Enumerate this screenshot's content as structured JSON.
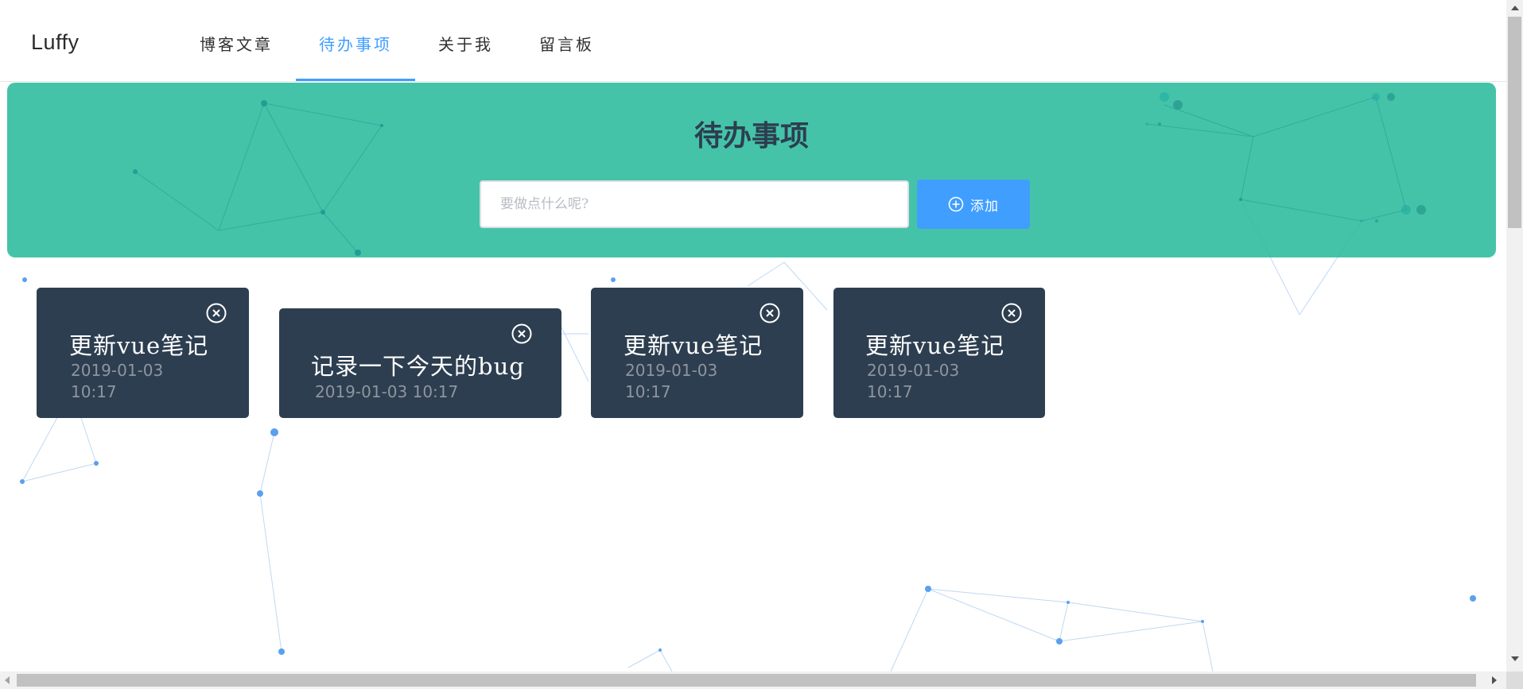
{
  "header": {
    "logo": "Luffy",
    "nav": [
      {
        "label": "博客文章",
        "active": false
      },
      {
        "label": "待办事项",
        "active": true
      },
      {
        "label": "关于我",
        "active": false
      },
      {
        "label": "留言板",
        "active": false
      }
    ]
  },
  "hero": {
    "title": "待办事项",
    "input_placeholder": "要做点什么呢?",
    "input_value": "",
    "add_button_label": "添加"
  },
  "todos": [
    {
      "title": "更新vue笔记",
      "date": "2019-01-03",
      "time": "10:17"
    },
    {
      "title": "记录一下今天的bug",
      "date": "2019-01-03",
      "time": "10:17"
    },
    {
      "title": "更新vue笔记",
      "date": "2019-01-03",
      "time": "10:17"
    },
    {
      "title": "更新vue笔记",
      "date": "2019-01-03",
      "time": "10:17"
    }
  ],
  "icons": {
    "add": "plus-circle-icon",
    "remove": "close-circle-icon"
  },
  "colors": {
    "accent": "#409eff",
    "hero_bg": "#27b99a",
    "card_bg": "#2d3e50",
    "title_text": "#2c3e50"
  }
}
